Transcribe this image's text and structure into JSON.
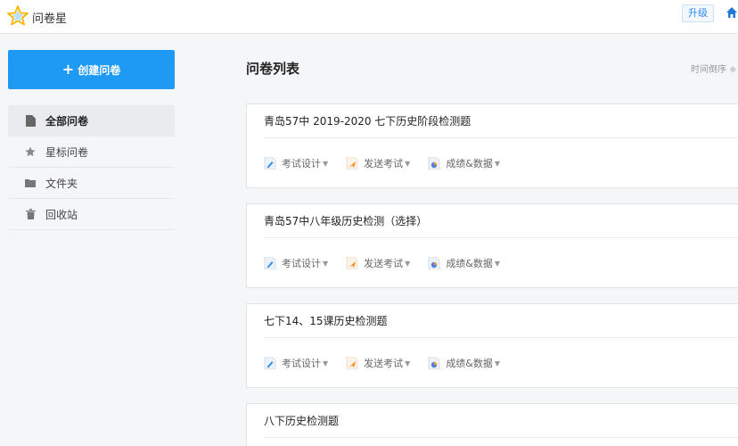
{
  "app": {
    "name": "问卷星",
    "upgrade_label": "升级"
  },
  "sidebar": {
    "create_label": "创建问卷",
    "items": [
      {
        "label": "全部问卷",
        "icon": "document-icon"
      },
      {
        "label": "星标问卷",
        "icon": "star-icon"
      },
      {
        "label": "文件夹",
        "icon": "folder-icon"
      },
      {
        "label": "回收站",
        "icon": "trash-icon"
      }
    ]
  },
  "main": {
    "title": "问卷列表",
    "sort_label": "时间倒序 ≑"
  },
  "actions": {
    "design": "考试设计",
    "send": "发送考试",
    "results": "成绩&数据"
  },
  "surveys": [
    {
      "title": "青岛57中 2019-2020 七下历史阶段检测题"
    },
    {
      "title": "青岛57中八年级历史检测（选择）"
    },
    {
      "title": "七下14、15课历史检测题"
    },
    {
      "title": "八下历史检测题"
    }
  ],
  "colors": {
    "accent": "#1e9af5",
    "star": "#f5b800"
  }
}
